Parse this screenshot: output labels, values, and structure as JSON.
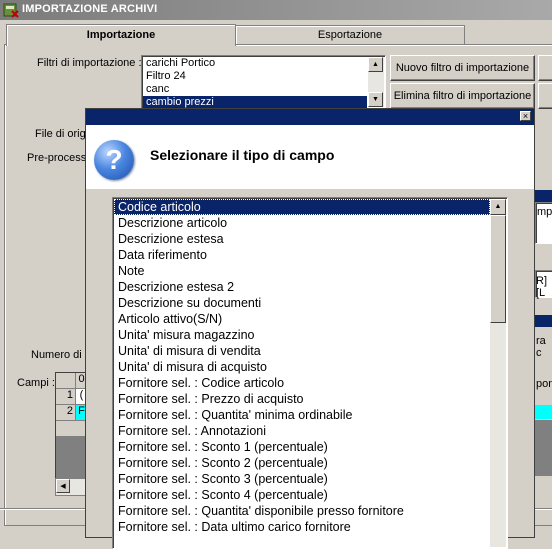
{
  "window": {
    "title": "IMPORTAZIONE ARCHIVI"
  },
  "tabs": [
    {
      "label": "Importazione",
      "active": true
    },
    {
      "label": "Esportazione",
      "active": false
    }
  ],
  "filters": {
    "label": "Filtri di importazione :",
    "items": [
      "carichi Portico",
      "Filtro 24",
      "canc",
      "cambio prezzi"
    ],
    "selected_index": 3,
    "new_button": "Nuovo filtro di importazione",
    "delete_button": "Elimina filtro di importazione"
  },
  "background_labels": {
    "file_origin": "File di orig",
    "preprocess": "Pre-process",
    "numero": "Numero di r",
    "campi": "Campi :",
    "right_fragment_1": "mpu",
    "right_fragment_2": "R][L",
    "right_fragment_3": "ra c",
    "right_fragment_4": "pon"
  },
  "background_grid": {
    "col0": "0",
    "rows": [
      "1",
      "2"
    ],
    "row1_fragment": "(",
    "row2_fragment": "F"
  },
  "dialog": {
    "close_glyph": "×",
    "icon": "question-icon",
    "prompt": "Selezionare il tipo di campo",
    "field_types": [
      "Codice articolo",
      "Descrizione articolo",
      "Descrizione estesa",
      "Data riferimento",
      "Note",
      "Descrizione estesa 2",
      "Descrizione su documenti",
      "Articolo attivo(S/N)",
      "Unita' misura magazzino",
      "Unita' di misura di vendita",
      "Unita' di misura di acquisto",
      "Fornitore sel. : Codice articolo",
      "Fornitore sel. : Prezzo di acquisto",
      "Fornitore sel. : Quantita' minima ordinabile",
      "Fornitore sel. : Annotazioni",
      "Fornitore sel. : Sconto 1 (percentuale)",
      "Fornitore sel. : Sconto 2 (percentuale)",
      "Fornitore sel. : Sconto 3 (percentuale)",
      "Fornitore sel. : Sconto 4 (percentuale)",
      "Fornitore sel. : Quantita' disponibile presso fornitore",
      "Fornitore sel. : Data ultimo carico fornitore"
    ],
    "selected_index": 0
  },
  "colors": {
    "selection": "#0a246a",
    "dialog_title": "#0a246a",
    "grid_highlight": "#00ffff"
  }
}
